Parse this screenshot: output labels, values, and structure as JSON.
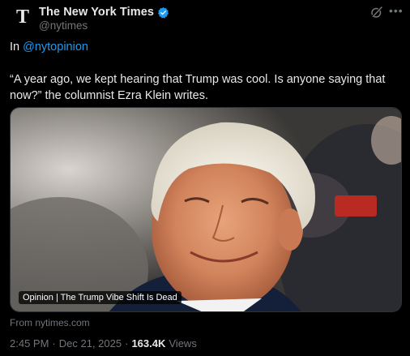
{
  "account": {
    "display_name": "The New York Times",
    "handle": "@nytimes",
    "logo_glyph": "T",
    "verified_color": "#1d9bf0"
  },
  "post": {
    "intro_prefix": "In ",
    "mention": "@nytopinion",
    "text": "“A year ago, we kept hearing that Trump was cool. Is anyone saying that now?” the columnist Ezra Klein writes."
  },
  "card": {
    "label": "Opinion | The Trump Vibe Shift Is Dead",
    "source": "From nytimes.com"
  },
  "meta": {
    "time": "2:45 PM",
    "separator": "·",
    "date": "Dec 21, 2025",
    "separator2": "·",
    "views_count": "163.4K",
    "views_label": "Views"
  },
  "icons": {
    "grok": "grok-icon",
    "more": "more-icon",
    "verified": "verified-badge-icon"
  },
  "colors": {
    "background": "#000000",
    "text": "#e7e9ea",
    "muted": "#71767b",
    "accent": "#1d9bf0"
  }
}
